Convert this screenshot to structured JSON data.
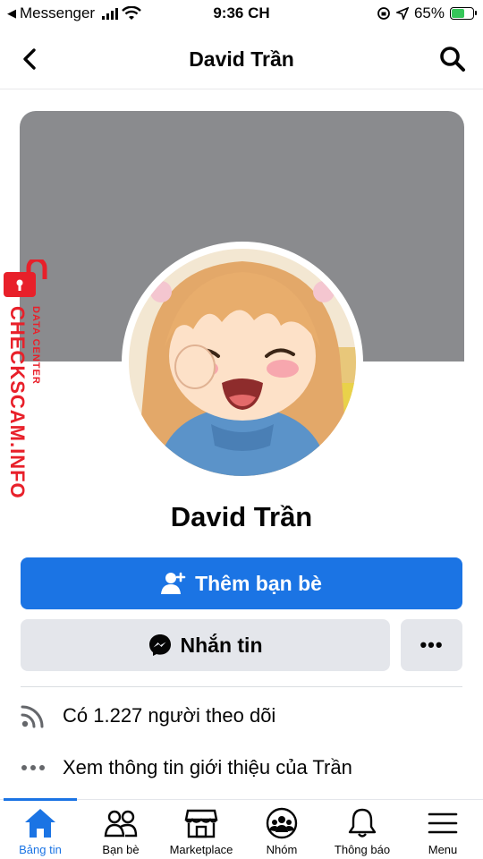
{
  "status_bar": {
    "back_app": "Messenger",
    "time": "9:36 CH",
    "battery_percent": "65%",
    "battery_level": 0.65
  },
  "header": {
    "title": "David Trần",
    "back_icon": "chevron-left-icon",
    "search_icon": "search-icon"
  },
  "profile": {
    "name": "David Trần",
    "cover_color": "#8a8b8e"
  },
  "actions": {
    "add_friend_label": "Thêm bạn bè",
    "message_label": "Nhắn tin",
    "more_label": "•••"
  },
  "info": {
    "followers_text": "Có 1.227 người theo dõi",
    "about_text": "Xem thông tin giới thiệu của Trần"
  },
  "watermark": {
    "brand": "CHECKSCAM.INFO",
    "subtitle": "DATA CENTER"
  },
  "tabs": [
    {
      "label": "Bảng tin",
      "icon": "home-icon",
      "active": true
    },
    {
      "label": "Bạn bè",
      "icon": "friends-icon",
      "active": false
    },
    {
      "label": "Marketplace",
      "icon": "store-icon",
      "active": false
    },
    {
      "label": "Nhóm",
      "icon": "groups-icon",
      "active": false
    },
    {
      "label": "Thông báo",
      "icon": "bell-icon",
      "active": false
    },
    {
      "label": "Menu",
      "icon": "menu-icon",
      "active": false
    }
  ],
  "colors": {
    "accent": "#1b74e4",
    "secondary_button": "#e4e6eb",
    "watermark": "#e8202a"
  }
}
